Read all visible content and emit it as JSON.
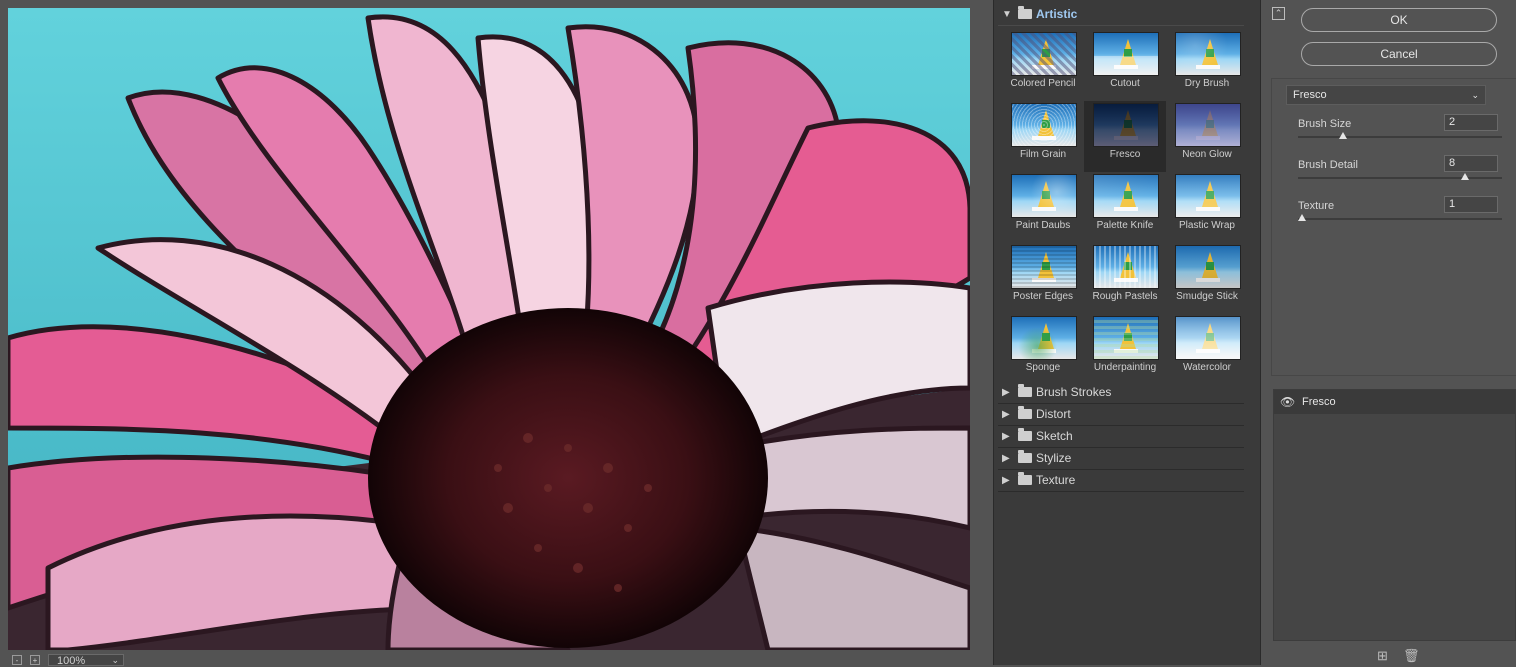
{
  "preview": {
    "zoom_value": "100%",
    "zoom_minus": "-",
    "zoom_plus": "+"
  },
  "gallery": {
    "open_category": {
      "label": "Artistic",
      "filters": [
        {
          "name": "Colored Pencil"
        },
        {
          "name": "Cutout"
        },
        {
          "name": "Dry Brush"
        },
        {
          "name": "Film Grain"
        },
        {
          "name": "Fresco",
          "selected": true
        },
        {
          "name": "Neon Glow"
        },
        {
          "name": "Paint Daubs"
        },
        {
          "name": "Palette Knife"
        },
        {
          "name": "Plastic Wrap"
        },
        {
          "name": "Poster Edges"
        },
        {
          "name": "Rough Pastels"
        },
        {
          "name": "Smudge Stick"
        },
        {
          "name": "Sponge"
        },
        {
          "name": "Underpainting"
        },
        {
          "name": "Watercolor"
        }
      ]
    },
    "collapsed_categories": [
      "Brush Strokes",
      "Distort",
      "Sketch",
      "Stylize",
      "Texture"
    ]
  },
  "buttons": {
    "ok": "OK",
    "cancel": "Cancel"
  },
  "settings": {
    "filter_select": "Fresco",
    "params": [
      {
        "label": "Brush Size",
        "value": "2",
        "fraction": 0.2
      },
      {
        "label": "Brush Detail",
        "value": "8",
        "fraction": 0.8
      },
      {
        "label": "Texture",
        "value": "1",
        "fraction": 0.0
      }
    ]
  },
  "layers": {
    "items": [
      {
        "name": "Fresco",
        "visible": true
      }
    ]
  },
  "icons": {
    "collapse": "collapse-panel-icon",
    "eye": "eye-icon",
    "new_layer": "new-effect-layer-icon",
    "delete": "trash-icon",
    "folder": "folder-icon"
  }
}
